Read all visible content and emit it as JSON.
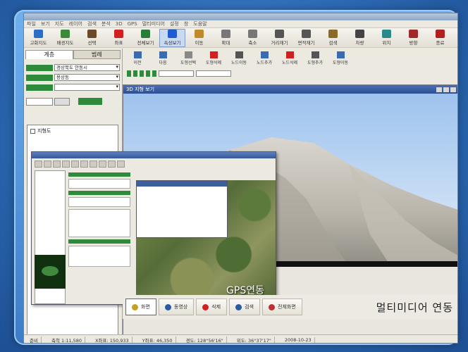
{
  "app": {
    "menu": [
      "파일",
      "보기",
      "지도",
      "레이어",
      "검색",
      "분석",
      "3D",
      "GPS",
      "멀티미디어",
      "설정",
      "창",
      "도움말"
    ],
    "toolbar1": [
      {
        "label": "고화지도",
        "icon": "map-icon",
        "color": "#2b6cc4"
      },
      {
        "label": "배경지도",
        "icon": "layers-icon",
        "color": "#3a8a3a"
      },
      {
        "label": "선택",
        "icon": "cursor-icon",
        "color": "#6b4a2b"
      },
      {
        "label": "좌표",
        "icon": "crosshair-icon",
        "color": "#d02020"
      },
      {
        "label": "전체보기",
        "icon": "globe-icon",
        "color": "#2a7a3a"
      },
      {
        "label": "속성보기",
        "icon": "info-icon",
        "color": "#1f5bd0"
      },
      {
        "label": "이동",
        "icon": "hand-icon",
        "color": "#c08a2a"
      },
      {
        "label": "확대",
        "icon": "zoom-in-icon",
        "color": "#777"
      },
      {
        "label": "축소",
        "icon": "zoom-out-icon",
        "color": "#777"
      },
      {
        "label": "거리재기",
        "icon": "ruler-icon",
        "color": "#555"
      },
      {
        "label": "면적재기",
        "icon": "area-icon",
        "color": "#555"
      },
      {
        "label": "검색",
        "icon": "search-icon",
        "color": "#8a6a2a"
      },
      {
        "label": "차량",
        "icon": "car-icon",
        "color": "#444"
      },
      {
        "label": "위치",
        "icon": "pin-icon",
        "color": "#2a8a8a"
      },
      {
        "label": "방향",
        "icon": "compass-icon",
        "color": "#a02a2a"
      },
      {
        "label": "종료",
        "icon": "exit-icon",
        "color": "#b02020"
      }
    ],
    "toolbar2": [
      "이전",
      "다음",
      "도형선택",
      "도형삭제",
      "노드이동",
      "노드추가",
      "노드삭제",
      "도형추가",
      "도형이동"
    ],
    "left_panel": {
      "tabs": [
        "계층",
        "범례"
      ],
      "rows": [
        {
          "label": "",
          "value": "경상북도 안동시"
        },
        {
          "label": "",
          "value": "용상동"
        },
        {
          "label": "",
          "value": ""
        }
      ],
      "tree_root": "지형도"
    },
    "view3d_title": "3D 지형 보기",
    "gps_window": {
      "overlay_label": "GPS연동"
    },
    "action_bar": {
      "buttons": [
        {
          "label": "화면",
          "color": "#c8a020",
          "active": true
        },
        {
          "label": "동영상",
          "color": "#2a5aa0",
          "active": false
        },
        {
          "label": "삭제",
          "color": "#d02020",
          "active": false
        },
        {
          "label": "검색",
          "color": "#2a5aa0",
          "active": false
        },
        {
          "label": "전체화면",
          "color": "#c03030",
          "active": false
        }
      ],
      "multimedia_label": "멀티미디어 연동"
    },
    "status": [
      "준비",
      "축척 1:11,580",
      "X좌표: 150,933",
      "Y좌표: 46,350",
      "경도: 128°56'16\"",
      "위도: 36°37'17\"",
      "2008-10-23"
    ]
  }
}
